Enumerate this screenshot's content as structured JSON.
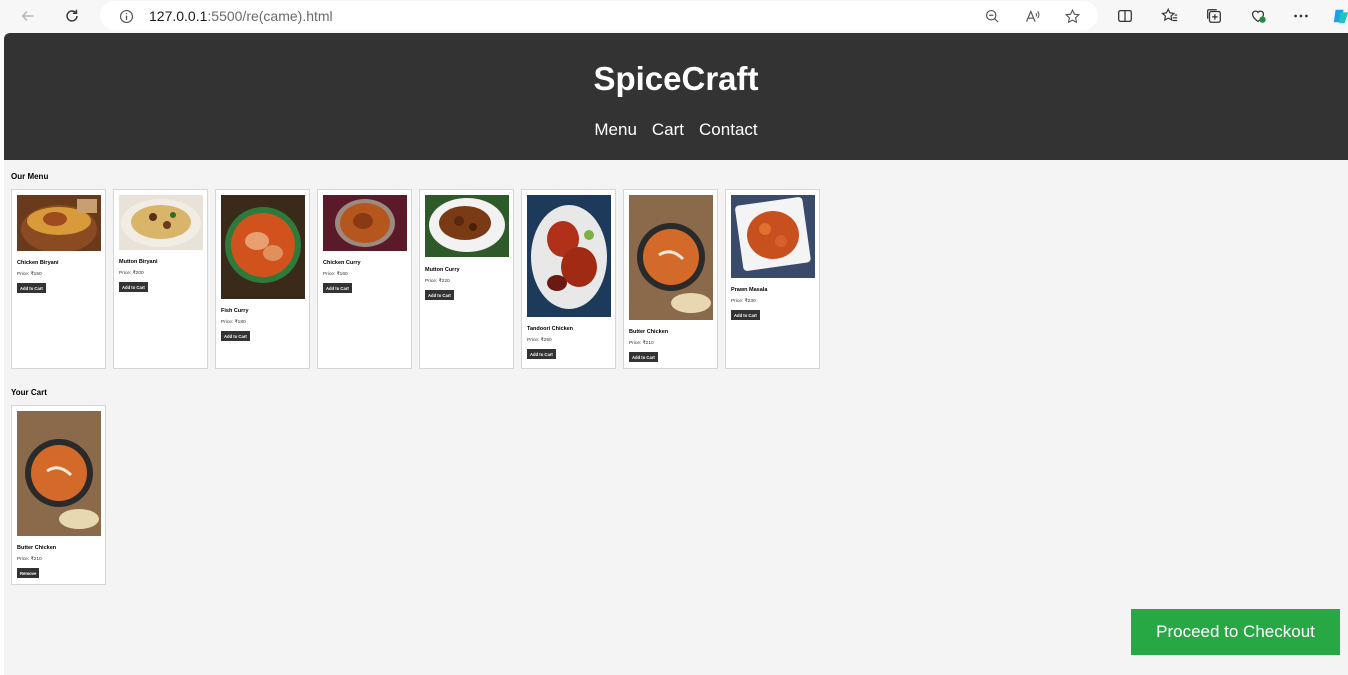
{
  "browser": {
    "url_host": "127.0.0.1",
    "url_rest": ":5500/re(came).html"
  },
  "site": {
    "brand": "SpiceCraft",
    "nav": [
      "Menu",
      "Cart",
      "Contact"
    ]
  },
  "menu": {
    "title": "Our Menu",
    "items": [
      {
        "name": "Chicken Biryani",
        "price": "Price: ₹150",
        "button": "Add to Cart"
      },
      {
        "name": "Mutton Biryani",
        "price": "Price: ₹200",
        "button": "Add to Cart"
      },
      {
        "name": "Fish Curry",
        "price": "Price: ₹180",
        "button": "Add to Cart"
      },
      {
        "name": "Chicken Curry",
        "price": "Price: ₹160",
        "button": "Add to Cart"
      },
      {
        "name": "Mutton Curry",
        "price": "Price: ₹220",
        "button": "Add to Cart"
      },
      {
        "name": "Tandoori Chicken",
        "price": "Price: ₹250",
        "button": "Add to Cart"
      },
      {
        "name": "Butter Chicken",
        "price": "Price: ₹210",
        "button": "Add to Cart"
      },
      {
        "name": "Prawn Masala",
        "price": "Price: ₹230",
        "button": "Add to Cart"
      }
    ]
  },
  "cart": {
    "title": "Your Cart",
    "items": [
      {
        "name": "Butter Chicken",
        "price": "Price: ₹210",
        "button": "Remove"
      }
    ]
  },
  "checkout_label": "Proceed to Checkout",
  "colors": {
    "header_bg": "#333333",
    "page_bg": "#f4f4f4",
    "checkout_bg": "#28a745"
  }
}
